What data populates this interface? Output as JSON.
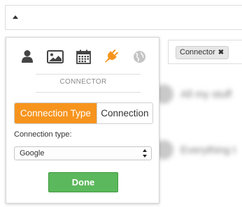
{
  "colors": {
    "accent": "#f7941d",
    "done_green": "#5cb85c",
    "icon_dark": "#444444",
    "icon_disabled": "#c4c4c4"
  },
  "background": {
    "items": [
      {
        "text": "All my stuff"
      },
      {
        "text": "Everything t"
      }
    ]
  },
  "tags": {
    "chip_label": "Connector",
    "remove_glyph": "✖"
  },
  "panel": {
    "icons": [
      {
        "name": "user-icon",
        "state": "default"
      },
      {
        "name": "image-icon",
        "state": "default"
      },
      {
        "name": "calendar-icon",
        "state": "default"
      },
      {
        "name": "plug-icon",
        "state": "active"
      },
      {
        "name": "globe-icon",
        "state": "disabled"
      }
    ],
    "section_label": "CONNECTOR",
    "tabs": [
      {
        "label": "Connection Type",
        "active": true
      },
      {
        "label": "Connection",
        "active": false
      }
    ],
    "field_label": "Connection type:",
    "select_value": "Google",
    "done_label": "Done"
  }
}
